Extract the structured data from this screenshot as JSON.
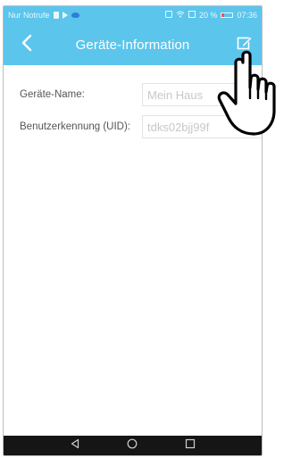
{
  "status_bar": {
    "carrier": "Nur Notrufe",
    "battery_percent": "20 %",
    "time": "07:36"
  },
  "app_bar": {
    "title": "Geräte-Information",
    "back_icon": "chevron-left-icon",
    "edit_icon": "edit-icon"
  },
  "form": {
    "device_name": {
      "label": "Geräte-Name:",
      "placeholder": "Mein Haus"
    },
    "uid": {
      "label": "Benutzerkennung (UID):",
      "value": "tdks02bjj99f"
    }
  },
  "nav_bar": {
    "back_icon": "triangle-back-icon",
    "home_icon": "circle-home-icon",
    "recents_icon": "square-recents-icon"
  },
  "overlay": {
    "pointer_icon": "hand-pointer-icon"
  },
  "colors": {
    "accent": "#5bc5ec",
    "nav_bar": "#151515",
    "field_text": "#c8c8c8",
    "label_text": "#555555"
  }
}
